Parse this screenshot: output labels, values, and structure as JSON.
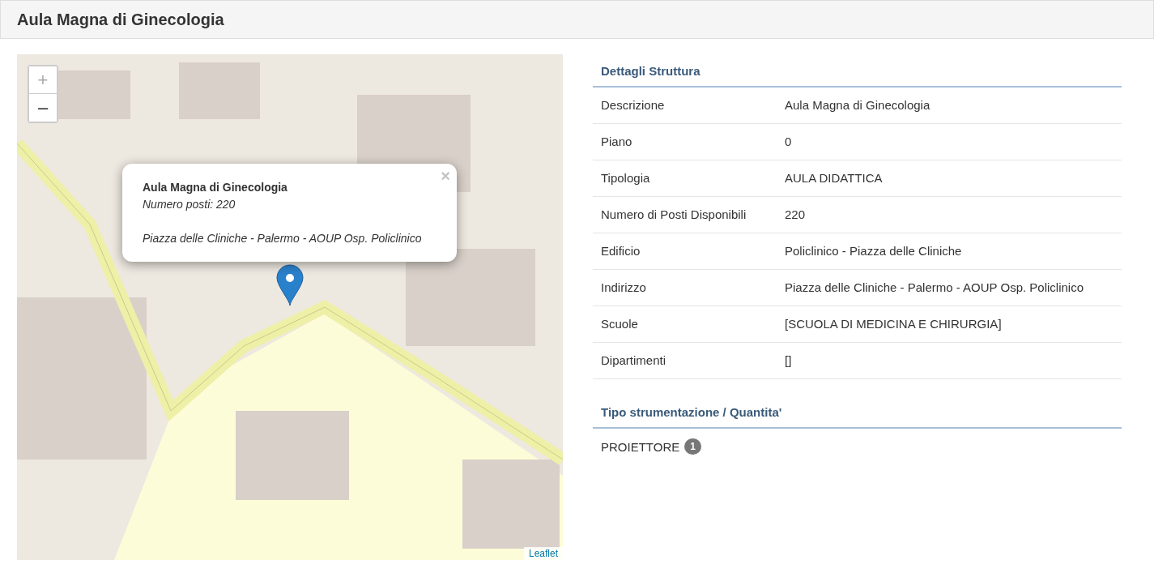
{
  "header": {
    "title": "Aula Magna di Ginecologia"
  },
  "map": {
    "zoom_in": "+",
    "zoom_out": "–",
    "attribution": "Leaflet",
    "popup": {
      "title": "Aula Magna di Ginecologia",
      "seats": "Numero posti: 220",
      "address": "Piazza delle Cliniche - Palermo - AOUP Osp. Policlinico",
      "close": "×"
    }
  },
  "details": {
    "title": "Dettagli Struttura",
    "rows": [
      {
        "label": "Descrizione",
        "value": "Aula Magna di Ginecologia"
      },
      {
        "label": "Piano",
        "value": "0"
      },
      {
        "label": "Tipologia",
        "value": "AULA DIDATTICA"
      },
      {
        "label": "Numero di Posti Disponibili",
        "value": "220"
      },
      {
        "label": "Edificio",
        "value": "Policlinico - Piazza delle Cliniche"
      },
      {
        "label": "Indirizzo",
        "value": "Piazza delle Cliniche - Palermo - AOUP Osp. Policlinico"
      },
      {
        "label": "Scuole",
        "value": "[SCUOLA DI MEDICINA E CHIRURGIA]"
      },
      {
        "label": "Dipartimenti",
        "value": "[]"
      }
    ]
  },
  "equipment": {
    "title": "Tipo strumentazione / Quantita'",
    "items": [
      {
        "name": "PROIETTORE",
        "count": "1"
      }
    ]
  }
}
